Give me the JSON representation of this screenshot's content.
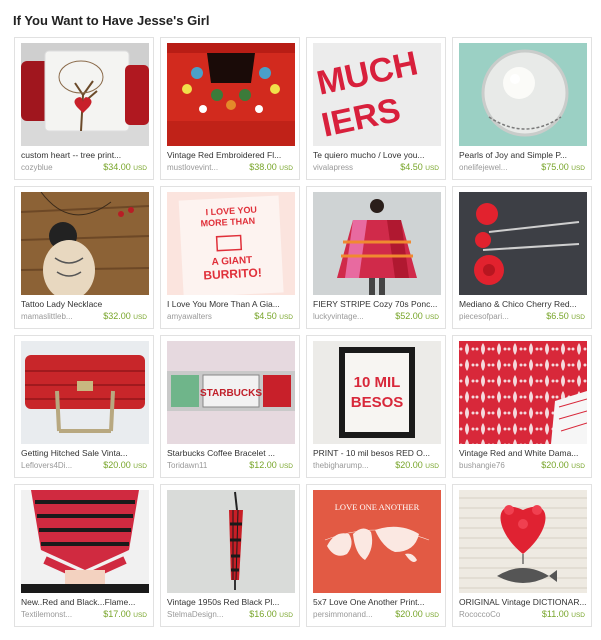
{
  "title": "If You Want to Have Jesse's Girl",
  "items": [
    {
      "name": "custom heart -- tree print...",
      "shop": "cozyblue",
      "price": "$34.00",
      "currency": "USD",
      "image": "pillow-tree-heart"
    },
    {
      "name": "Vintage Red Embroidered Fl...",
      "shop": "mustlovevint...",
      "price": "$38.00",
      "currency": "USD",
      "image": "red-embroidered-dress"
    },
    {
      "name": "Te quiero mucho / Love you...",
      "shop": "vivalapress",
      "price": "$4.50",
      "currency": "USD",
      "image": "te-quiero-print"
    },
    {
      "name": "Pearls of Joy and Simple P...",
      "shop": "onelifejewel...",
      "price": "$75.00",
      "currency": "USD",
      "image": "pearl-pendant"
    },
    {
      "name": "Tattoo Lady Necklace",
      "shop": "mamaslittleb...",
      "price": "$32.00",
      "currency": "USD",
      "image": "tattoo-lady-necklace"
    },
    {
      "name": "I Love You More Than A Gia...",
      "shop": "amyawalters",
      "price": "$4.50",
      "currency": "USD",
      "image": "burrito-print"
    },
    {
      "name": "FIERY STRIPE Cozy 70s Ponc...",
      "shop": "luckyvintage...",
      "price": "$52.00",
      "currency": "USD",
      "image": "striped-poncho"
    },
    {
      "name": "Mediano & Chico Cherry Red...",
      "shop": "piecesofpari...",
      "price": "$6.50",
      "currency": "USD",
      "image": "red-flower-pins"
    },
    {
      "name": "Getting Hitched Sale Vinta...",
      "shop": "Leflovers4Di...",
      "price": "$20.00",
      "currency": "USD",
      "image": "red-wicker-bag"
    },
    {
      "name": "Starbucks Coffee Bracelet ...",
      "shop": "Toridawn11",
      "price": "$12.00",
      "currency": "USD",
      "image": "starbucks-bracelet"
    },
    {
      "name": "PRINT - 10 mil besos RED O...",
      "shop": "thebigharump...",
      "price": "$20.00",
      "currency": "USD",
      "image": "mil-besos-print"
    },
    {
      "name": "Vintage Red and White Dama...",
      "shop": "bushangie76",
      "price": "$20.00",
      "currency": "USD",
      "image": "damask-fabric"
    },
    {
      "name": "New..Red and Black...Flame...",
      "shop": "Textilemonst...",
      "price": "$17.00",
      "currency": "USD",
      "image": "ruffle-scarf"
    },
    {
      "name": "Vintage 1950s Red Black Pl...",
      "shop": "StelmaDesign...",
      "price": "$16.00",
      "currency": "USD",
      "image": "plaid-umbrella"
    },
    {
      "name": "5x7 Love One Another Print...",
      "shop": "persimmonand...",
      "price": "$20.00",
      "currency": "USD",
      "image": "love-one-another-print"
    },
    {
      "name": "ORIGINAL Vintage DICTIONAR...",
      "shop": "RococcoCo",
      "price": "$11.00",
      "currency": "USD",
      "image": "heart-balloon-whale"
    }
  ],
  "thumb_text": {
    "burrito": [
      "I LOVE YOU",
      "MORE THAN",
      "A GIANT",
      "BURRITO!"
    ],
    "mil_besos": [
      "10 MIL",
      "BESOS"
    ],
    "love_one_another": "LOVE ONE ANOTHER",
    "starbucks": "STARBUCKS"
  },
  "colors": {
    "price": "#78a52a",
    "shop": "#999999",
    "border": "#e1e1e1"
  }
}
